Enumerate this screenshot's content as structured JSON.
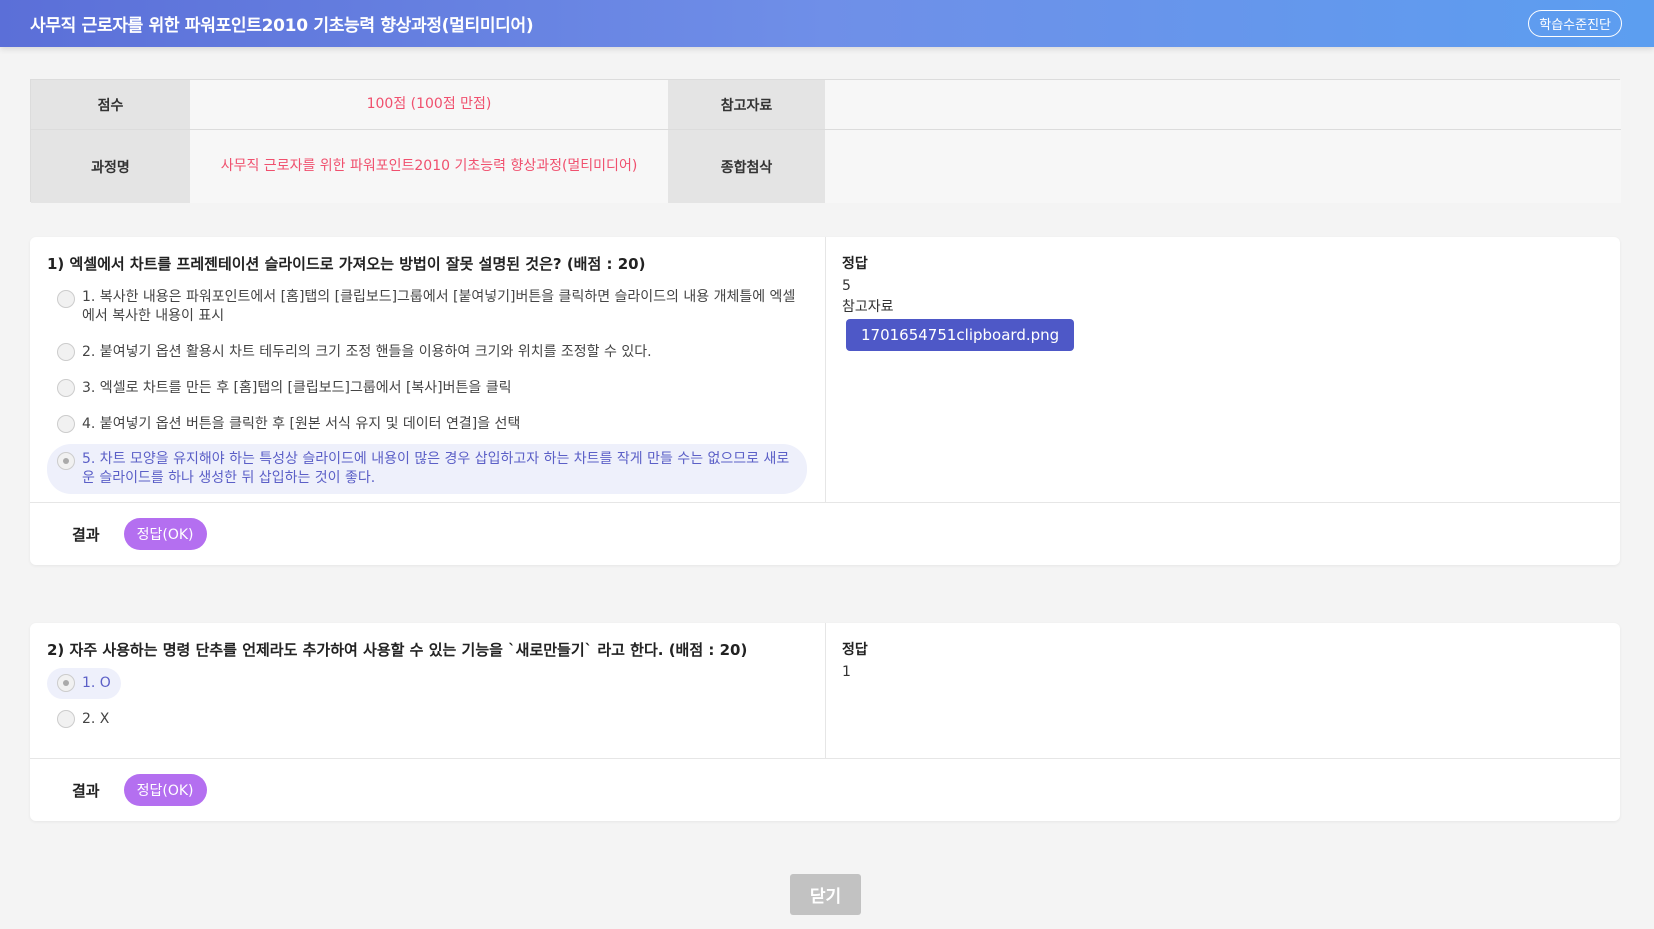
{
  "header": {
    "title": "사무직 근로자를 위한 파워포인트2010 기초능력 향상과정(멀티미디어)",
    "diag_button": "학습수준진단"
  },
  "info": {
    "score_label": "점수",
    "score_value": "100점 (100점 만점)",
    "ref_label": "참고자료",
    "ref_value": "",
    "course_label": "과정명",
    "course_value": "사무직 근로자를 위한 파워포인트2010 기초능력 향상과정(멀티미디어)",
    "attach_label": "종합첨삭",
    "attach_value": ""
  },
  "questions": [
    {
      "title": "1) 엑셀에서 차트를 프레젠테이션 슬라이드로 가져오는 방법이 잘못 설명된 것은? (배점 : 20)",
      "options": [
        "1. 복사한 내용은 파워포인트에서 [홈]탭의 [클립보드]그룹에서 [붙여넣기]버튼을 클릭하면 슬라이드의 내용 개체틀에 엑셀에서 복사한 내용이 표시",
        "2. 붙여넣기 옵션 활용시 차트 테두리의 크기 조정 핸들을 이용하여 크기와 위치를 조정할 수 있다.",
        "3. 엑셀로 차트를 만든 후 [홈]탭의 [클립보드]그룹에서 [복사]버튼을 클릭",
        "4. 붙여넣기 옵션 버튼을 클릭한 후 [원본 서식 유지 및 데이터 연결]을 선택",
        "5. 차트 모양을 유지해야 하는 특성상 슬라이드에 내용이 많은 경우 삽입하고자 하는 차트를 작게 만들 수는 없으므로 새로운 슬라이드를 하나 생성한 뒤 삽입하는 것이 좋다."
      ],
      "selected_index": 4,
      "answer_label": "정답",
      "answer_value": "5",
      "ref_label": "참고자료",
      "ref_file": "1701654751clipboard.png",
      "result_label": "결과",
      "result_value": "정답(OK)"
    },
    {
      "title": "2) 자주 사용하는 명령 단추를 언제라도 추가하여 사용할 수 있는 기능을 `새로만들기` 라고 한다. (배점 : 20)",
      "options": [
        "1. O",
        "2. X"
      ],
      "selected_index": 0,
      "answer_label": "정답",
      "answer_value": "1",
      "result_label": "결과",
      "result_value": "정답(OK)"
    }
  ],
  "close_button": "닫기",
  "colors": {
    "accent": "#4e58c7",
    "score": "#f0506e",
    "badge": "#b46ff0"
  }
}
